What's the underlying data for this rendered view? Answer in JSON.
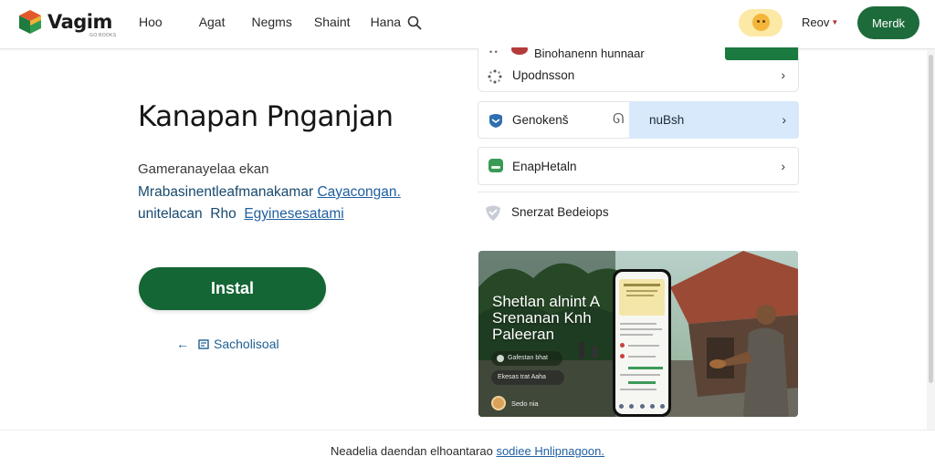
{
  "header": {
    "logo_name": "Vagim",
    "logo_tagline": "GO BOOKS",
    "nav": [
      "Hoo",
      "Agat",
      "Negms",
      "Shaint",
      "Hana"
    ],
    "account_label": "Reov",
    "cta_label": "Merdk"
  },
  "hero": {
    "title": "Kanapan Pnganjan",
    "lead": "Gameranayelaa ekan",
    "body_line1_text": "Mrabasinentleafmanakamar ",
    "body_line1_link": "Cayacongan.",
    "body_line2_text": "unitelacan  Rho  ",
    "body_line2_link": "Egyinesesatami",
    "install_label": "Instal",
    "back_label": "Sacholisoal"
  },
  "side": {
    "top_row_text": "Binohanenn hunnaar",
    "top_row_ticks": "• •",
    "item1": "Upodnsson",
    "item2_left": "Genokenš",
    "item2_right": "nuBsh",
    "item3": "EnapHetaln",
    "item4": "Snerzat Bedeiops"
  },
  "promo": {
    "title": "Shetlan alnint A Srenanan Knh Paleeran",
    "chip1": "Gafestan bhat",
    "chip2": "Ekesas trat Aaha",
    "footer": "Sedo nia"
  },
  "footer": {
    "text": "Neadelia daendan elhoantarao ",
    "link": "sodiee Hnlipnagoon."
  },
  "colors": {
    "brand_green": "#146635",
    "link_blue": "#1f5fa0",
    "highlight_blue": "#d8e9fb"
  }
}
